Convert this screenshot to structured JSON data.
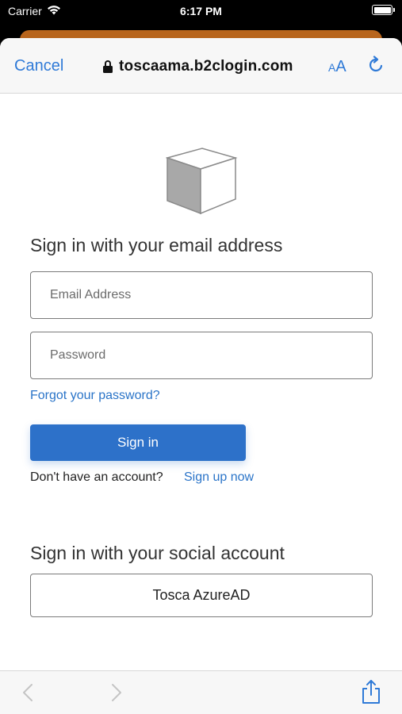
{
  "status_bar": {
    "carrier": "Carrier",
    "time": "6:17 PM"
  },
  "nav": {
    "cancel_label": "Cancel",
    "url": "toscaama.b2clogin.com",
    "aa_small": "A",
    "aa_large": "A"
  },
  "form": {
    "heading": "Sign in with your email address",
    "email_placeholder": "Email Address",
    "password_placeholder": "Password",
    "forgot_label": "Forgot your password?",
    "signin_label": "Sign in",
    "no_account_text": "Don't have an account?",
    "signup_label": "Sign up now"
  },
  "social": {
    "heading": "Sign in with your social account",
    "provider_label": "Tosca AzureAD"
  },
  "colors": {
    "accent": "#2f7ad7",
    "primary_button": "#2d71c9",
    "link": "#2a74c8",
    "background_sheet": "#b8651c"
  },
  "icons": {
    "wifi": "wifi-icon",
    "battery": "battery-icon",
    "lock": "lock-icon",
    "reload": "reload-icon",
    "logo": "cube-logo-icon",
    "back": "chevron-left-icon",
    "forward": "chevron-right-icon",
    "share": "share-icon"
  }
}
